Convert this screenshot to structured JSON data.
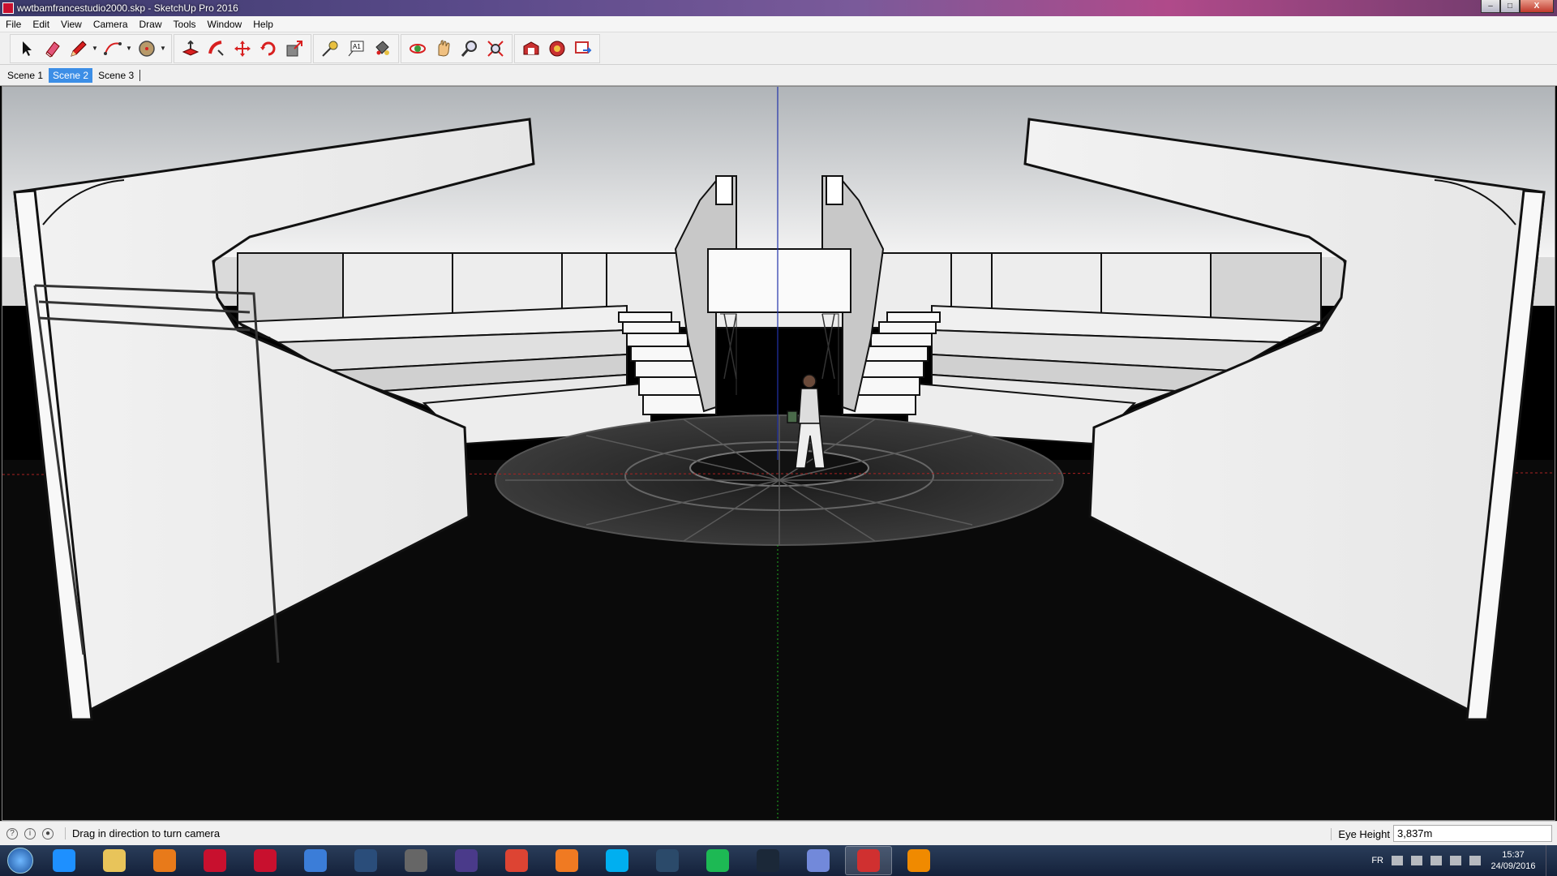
{
  "window": {
    "title": "wwtbamfrancestudio2000.skp - SketchUp Pro 2016",
    "controls": {
      "minimize": "–",
      "maximize": "□",
      "close": "X"
    }
  },
  "menu": [
    "File",
    "Edit",
    "View",
    "Camera",
    "Draw",
    "Tools",
    "Window",
    "Help"
  ],
  "toolbar": {
    "tools": [
      "select-icon",
      "eraser-icon",
      "pencil-icon",
      "arc-icon",
      "circle-icon",
      "push-pull-icon",
      "follow-me-icon",
      "move-icon",
      "rotate-icon",
      "scale-icon",
      "tape-measure-icon",
      "text-icon",
      "paint-bucket-icon",
      "orbit-icon",
      "pan-icon",
      "zoom-icon",
      "zoom-extents-icon",
      "warehouse-icon",
      "extension-warehouse-icon",
      "send-to-layout-icon"
    ]
  },
  "scenes": {
    "tabs": [
      "Scene 1",
      "Scene 2",
      "Scene 3"
    ],
    "active": "Scene 2"
  },
  "status": {
    "message": "Drag in direction to turn camera",
    "measure_label": "Eye Height",
    "measure_value": "3,837m"
  },
  "taskbar": {
    "apps": [
      "internet-explorer-icon",
      "file-explorer-icon",
      "media-player-icon",
      "cinema-app-icon",
      "cinema-app-2-icon",
      "globe-app-icon",
      "notes-app-icon",
      "steam-settings-icon",
      "headphones-app-icon",
      "chrome-icon",
      "firefox-icon",
      "skype-icon",
      "teamspeak-icon",
      "spotify-icon",
      "steam-icon",
      "discord-icon",
      "sketchup-icon",
      "vlc-icon"
    ],
    "app_colors": [
      "#1e90ff",
      "#e8c45a",
      "#e87a1a",
      "#c8102e",
      "#c8102e",
      "#3b7dd8",
      "#2a4d7a",
      "#666666",
      "#4a3a8a",
      "#dd4433",
      "#f07a22",
      "#00aff0",
      "#2b4a6a",
      "#1db954",
      "#1b2838",
      "#7289da",
      "#d03030",
      "#f08a00"
    ],
    "active_app": "sketchup-icon",
    "language": "FR",
    "time": "15:37",
    "date": "24/09/2016"
  }
}
